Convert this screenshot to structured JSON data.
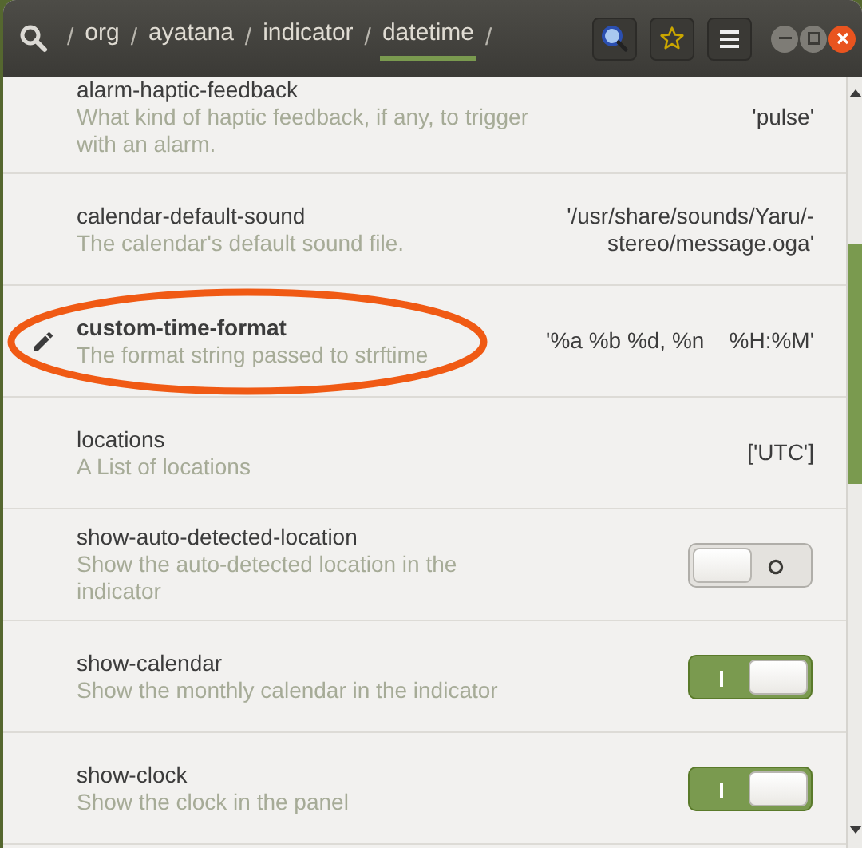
{
  "header": {
    "path": [
      {
        "label": "org",
        "separator": "/",
        "selected": false
      },
      {
        "label": "ayatana",
        "separator": "/",
        "selected": false
      },
      {
        "label": "indicator",
        "separator": "/",
        "selected": false
      },
      {
        "label": "datetime",
        "separator": "/",
        "selected": true
      }
    ],
    "trailing_separator": "/"
  },
  "keys": [
    {
      "kind": "text",
      "name": "alarm-haptic-feedback",
      "description": "What kind of haptic feedback, if any, to trigger with an alarm.",
      "value": "'pulse'",
      "modified": false,
      "annotated": false
    },
    {
      "kind": "text",
      "name": "calendar-default-sound",
      "description": "The calendar's default sound file.",
      "value": "'/usr/share/sounds/Yaru/-stereo/message.oga'",
      "modified": false,
      "annotated": false
    },
    {
      "kind": "text",
      "name": "custom-time-format",
      "description": "The format string passed to strftime",
      "value": "'%a %b %d, %n    %H:%M'",
      "modified": true,
      "annotated": true
    },
    {
      "kind": "text",
      "name": "locations",
      "description": "A List of locations",
      "value": "['UTC']",
      "modified": false,
      "annotated": false
    },
    {
      "kind": "switch",
      "name": "show-auto-detected-location",
      "description": "Show the auto-detected location in the indicator",
      "on": false,
      "modified": false,
      "annotated": false
    },
    {
      "kind": "switch",
      "name": "show-calendar",
      "description": "Show the monthly calendar in the indicator",
      "on": true,
      "modified": false,
      "annotated": false
    },
    {
      "kind": "switch",
      "name": "show-clock",
      "description": "Show the clock in the panel",
      "on": true,
      "modified": false,
      "annotated": false
    }
  ]
}
